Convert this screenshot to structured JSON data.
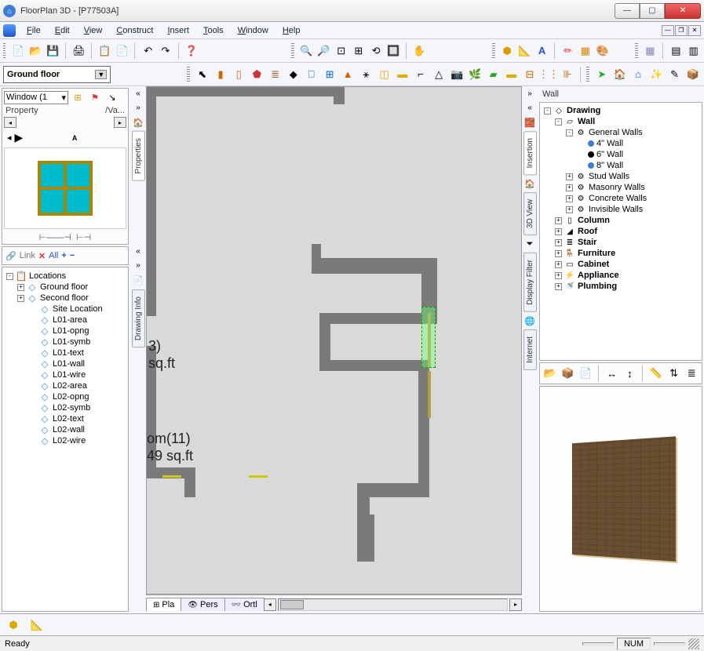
{
  "app": {
    "title": "FloorPlan 3D - [P77503A]"
  },
  "menu": [
    "File",
    "Edit",
    "View",
    "Construct",
    "Insert",
    "Tools",
    "Window",
    "Help"
  ],
  "floor_selector": "Ground floor",
  "left": {
    "object_select": "Window (1",
    "prop_header": {
      "col1": "Property",
      "col2": "Va..."
    },
    "mid_tb": {
      "link": "Link",
      "all": "All"
    },
    "tree": [
      {
        "indent": 0,
        "exp": "-",
        "icon": "📋",
        "label": "Locations"
      },
      {
        "indent": 1,
        "exp": "+",
        "icon": "◇",
        "label": "Ground floor"
      },
      {
        "indent": 1,
        "exp": "+",
        "icon": "◇",
        "label": "Second floor"
      },
      {
        "indent": 2,
        "exp": "",
        "icon": "◇",
        "label": "Site Location"
      },
      {
        "indent": 2,
        "exp": "",
        "icon": "◇",
        "label": "L01-area"
      },
      {
        "indent": 2,
        "exp": "",
        "icon": "◇",
        "label": "L01-opng"
      },
      {
        "indent": 2,
        "exp": "",
        "icon": "◇",
        "label": "L01-symb"
      },
      {
        "indent": 2,
        "exp": "",
        "icon": "◇",
        "label": "L01-text"
      },
      {
        "indent": 2,
        "exp": "",
        "icon": "◇",
        "label": "L01-wall"
      },
      {
        "indent": 2,
        "exp": "",
        "icon": "◇",
        "label": "L01-wire"
      },
      {
        "indent": 2,
        "exp": "",
        "icon": "◇",
        "label": "L02-area"
      },
      {
        "indent": 2,
        "exp": "",
        "icon": "◇",
        "label": "L02-opng"
      },
      {
        "indent": 2,
        "exp": "",
        "icon": "◇",
        "label": "L02-symb"
      },
      {
        "indent": 2,
        "exp": "",
        "icon": "◇",
        "label": "L02-text"
      },
      {
        "indent": 2,
        "exp": "",
        "icon": "◇",
        "label": "L02-wall"
      },
      {
        "indent": 2,
        "exp": "",
        "icon": "◇",
        "label": "L02-wire"
      }
    ]
  },
  "vtabs_left": [
    "Properties",
    "Drawing Info"
  ],
  "vtabs_right1": [
    "Insertion",
    "3D View",
    "Display Filter",
    "Internet"
  ],
  "canvas_tabs": [
    "Pla",
    "Pers",
    "Ortl"
  ],
  "canvas_labels": {
    "room13_suffix": "3)",
    "room13_area": "sq.ft",
    "room11": "om(11)",
    "room11_area": "49 sq.ft"
  },
  "right": {
    "header": "Wall",
    "tree": [
      {
        "indent": 0,
        "exp": "-",
        "icon": "◇",
        "label": "Drawing",
        "bold": true
      },
      {
        "indent": 1,
        "exp": "-",
        "icon": "▱",
        "label": "Wall",
        "bold": true
      },
      {
        "indent": 2,
        "exp": "-",
        "icon": "⚙",
        "label": "General Walls"
      },
      {
        "indent": 3,
        "exp": "",
        "bullet": "blue",
        "label": "4\" Wall"
      },
      {
        "indent": 3,
        "exp": "",
        "bullet": "black",
        "label": "6\" Wall"
      },
      {
        "indent": 3,
        "exp": "",
        "bullet": "blue",
        "label": "8\" Wall"
      },
      {
        "indent": 2,
        "exp": "+",
        "icon": "⚙",
        "label": "Stud Walls"
      },
      {
        "indent": 2,
        "exp": "+",
        "icon": "⚙",
        "label": "Masonry Walls"
      },
      {
        "indent": 2,
        "exp": "+",
        "icon": "⚙",
        "label": "Concrete Walls"
      },
      {
        "indent": 2,
        "exp": "+",
        "icon": "⚙",
        "label": "Invisible Walls"
      },
      {
        "indent": 1,
        "exp": "+",
        "icon": "▯",
        "label": "Column",
        "bold": true
      },
      {
        "indent": 1,
        "exp": "+",
        "icon": "◢",
        "label": "Roof",
        "bold": true
      },
      {
        "indent": 1,
        "exp": "+",
        "icon": "≣",
        "label": "Stair",
        "bold": true
      },
      {
        "indent": 1,
        "exp": "+",
        "icon": "🪑",
        "label": "Furniture",
        "bold": true
      },
      {
        "indent": 1,
        "exp": "+",
        "icon": "▭",
        "label": "Cabinet",
        "bold": true
      },
      {
        "indent": 1,
        "exp": "+",
        "icon": "⚡",
        "label": "Appliance",
        "bold": true
      },
      {
        "indent": 1,
        "exp": "+",
        "icon": "🚿",
        "label": "Plumbing",
        "bold": true
      }
    ]
  },
  "status": {
    "ready": "Ready",
    "num": "NUM"
  }
}
